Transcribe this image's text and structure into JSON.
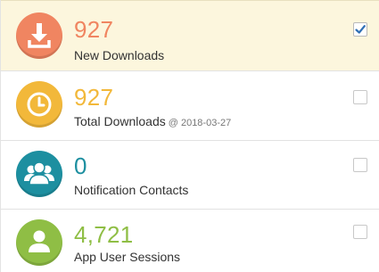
{
  "colors": {
    "orange": "#f08561",
    "yellow": "#f2b83a",
    "teal": "#1d8fa0",
    "green": "#8fbe45",
    "check": "#2f6fb5",
    "selected_bg": "#fcf6dd"
  },
  "metrics": [
    {
      "value": "927",
      "label": "New Downloads",
      "date": "",
      "icon": "download-icon",
      "color": "#f08561",
      "circle_color": "#f08561",
      "checked": true
    },
    {
      "value": "927",
      "label": "Total Downloads",
      "date": "@ 2018-03-27",
      "icon": "clock-icon",
      "color": "#f2b83a",
      "circle_color": "#f2b83a",
      "checked": false
    },
    {
      "value": "0",
      "label": "Notification Contacts",
      "date": "",
      "icon": "users-group-icon",
      "color": "#1d8fa0",
      "circle_color": "#1d8fa0",
      "checked": false
    },
    {
      "value": "4,721",
      "label": "App User Sessions",
      "date": "",
      "icon": "user-icon",
      "color": "#8fbe45",
      "circle_color": "#8fbe45",
      "checked": false
    }
  ]
}
